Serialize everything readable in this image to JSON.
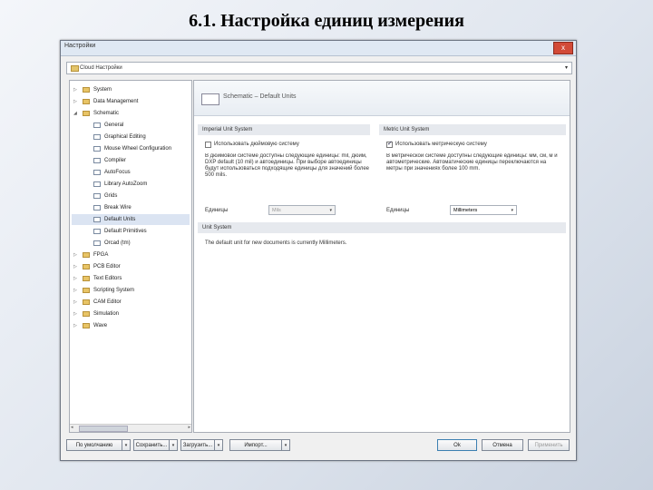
{
  "slide": {
    "title": "6.1. Настройка единиц измерения"
  },
  "window": {
    "title": "Настройки",
    "close_glyph": "x"
  },
  "settings_combo": {
    "label": "Cloud Настройки",
    "arrow": "▾"
  },
  "tree": {
    "expand_glyph": "▷",
    "collapse_glyph": "◢",
    "items": [
      {
        "label": "System"
      },
      {
        "label": "Data Management"
      },
      {
        "label": "Schematic"
      },
      {
        "label": "General"
      },
      {
        "label": "Graphical Editing"
      },
      {
        "label": "Mouse Wheel Configuration"
      },
      {
        "label": "Compiler"
      },
      {
        "label": "AutoFocus"
      },
      {
        "label": "Library AutoZoom"
      },
      {
        "label": "Grids"
      },
      {
        "label": "Break Wire"
      },
      {
        "label": "Default Units"
      },
      {
        "label": "Default Primitives"
      },
      {
        "label": "Orcad (tm)"
      },
      {
        "label": "FPGA"
      },
      {
        "label": "PCB Editor"
      },
      {
        "label": "Text Editors"
      },
      {
        "label": "Scripting System"
      },
      {
        "label": "CAM Editor"
      },
      {
        "label": "Simulation"
      },
      {
        "label": "Wave"
      }
    ],
    "scroll_left": "◂",
    "scroll_right": "▸"
  },
  "content": {
    "header": "Schematic – Default Units",
    "imperial": {
      "section": "Imperial Unit System",
      "checkbox_label": "Использовать дюймовую систему",
      "checked": false,
      "description": "В дюймовой системе доступны следующие единицы: mil, дюйм, DXP default (10 mil) и автоединицы. При выборе автоединицы будут использоваться подходящие единицы для значений более 500 mils.",
      "unit_label": "Единицы",
      "unit_value": "Mils"
    },
    "metric": {
      "section": "Metric Unit System",
      "checkbox_label": "Использовать метрическую систему",
      "checked": true,
      "description": "В метрической системе доступны следующие единицы: мм, см, м и автометрические. Автоматические единицы переключаются на метры при значениях более 100 mm.",
      "unit_label": "Единицы",
      "unit_value": "Millimeters"
    },
    "unit_system": {
      "section": "Unit System",
      "text": "The default unit for new documents is currently Millimeters."
    }
  },
  "footer": {
    "defaults_label": "По умолчанию",
    "save_label": "Сохранить...",
    "load_label": "Загрузить...",
    "import_label": "Импорт...",
    "split_glyph": "▾",
    "ok_label": "Ok",
    "cancel_label": "Отмена",
    "apply_label": "Применить"
  }
}
